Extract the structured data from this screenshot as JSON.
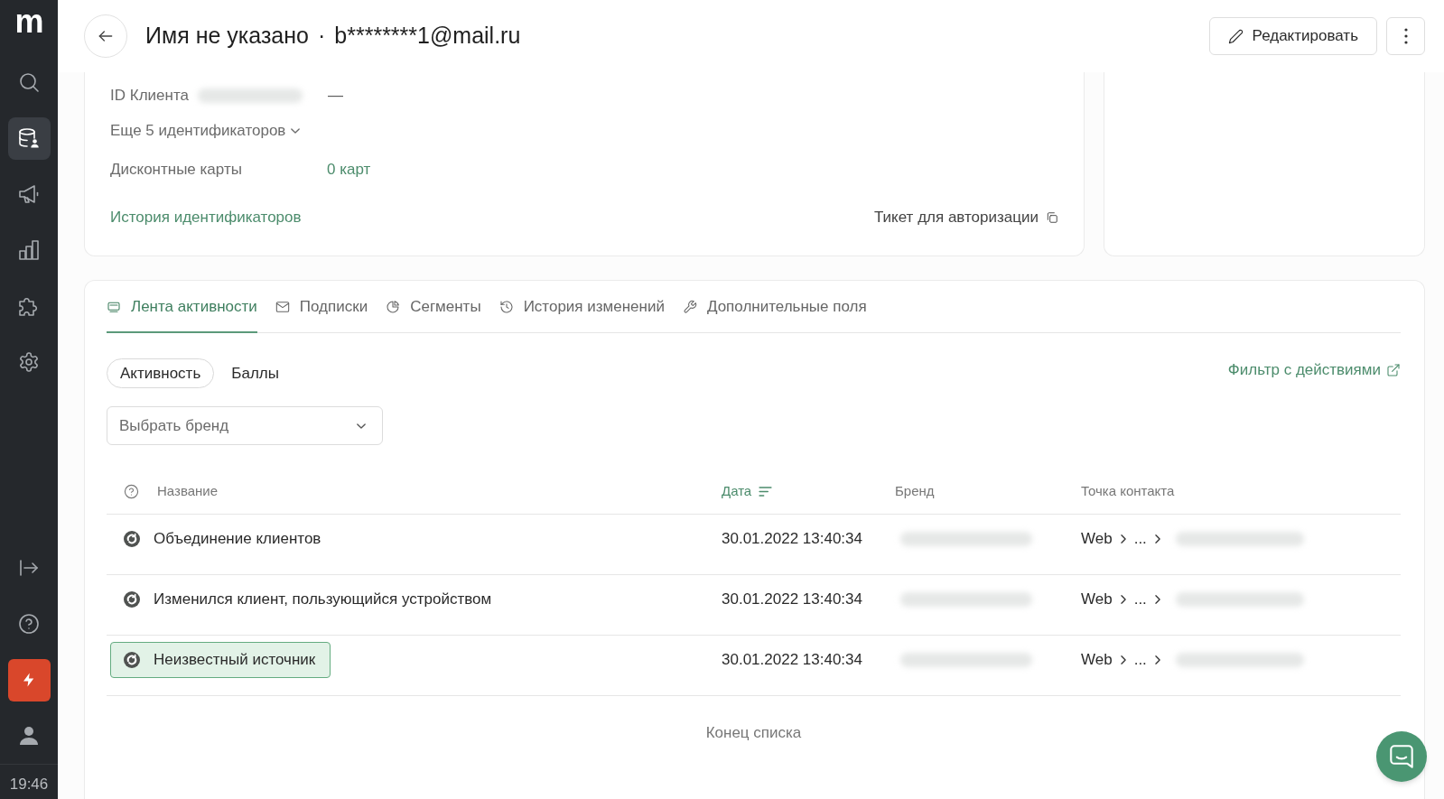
{
  "sidebar": {
    "logo": "m",
    "nav_items": [
      {
        "selected": false
      },
      {
        "selected": true
      },
      {
        "selected": false
      },
      {
        "selected": false
      },
      {
        "selected": false
      },
      {
        "selected": false
      }
    ],
    "time": "19:46"
  },
  "header": {
    "title": "Имя не указано",
    "separator": "·",
    "email": "b********1@mail.ru",
    "edit_button": "Редактировать"
  },
  "client_card": {
    "client_id": {
      "label": "ID Клиента",
      "redacted": true,
      "value": "—"
    },
    "more_identifiers": {
      "label": "Еще 5 идентификаторов",
      "expanded": false
    },
    "discount_cards": {
      "label": "Дисконтные карты",
      "value": "0 карт"
    },
    "history_link": "История идентификаторов",
    "ticket_link": "Тикет для авторизации"
  },
  "activity": {
    "tabs": [
      {
        "label": "Лента активности",
        "selected": true
      },
      {
        "label": "Подписки",
        "selected": false
      },
      {
        "label": "Сегменты",
        "selected": false
      },
      {
        "label": "История изменений",
        "selected": false
      },
      {
        "label": "Дополнительные поля",
        "selected": false
      }
    ],
    "view_toggle": [
      {
        "label": "Активность",
        "selected": true
      },
      {
        "label": "Баллы",
        "selected": false
      }
    ],
    "filter_link": "Фильтр с действиями",
    "brand_select": {
      "placeholder": "Выбрать бренд"
    },
    "table": {
      "columns": [
        {
          "label": "Название",
          "sorted": false
        },
        {
          "label": "Дата",
          "sorted": true
        },
        {
          "label": "Бренд",
          "sorted": false
        },
        {
          "label": "Точка контакта",
          "sorted": false
        }
      ],
      "rows": [
        {
          "name": "Объединение клиентов",
          "date": "30.01.2022 13:40:34",
          "brand_redacted": true,
          "contact_path": [
            "Web",
            "..."
          ],
          "contact_redacted": true,
          "selected": false
        },
        {
          "name": "Изменился клиент, пользующийся устройством",
          "date": "30.01.2022 13:40:34",
          "brand_redacted": true,
          "contact_path": [
            "Web",
            "..."
          ],
          "contact_redacted": true,
          "selected": false
        },
        {
          "name": "Неизвестный источник",
          "date": "30.01.2022 13:40:34",
          "brand_redacted": true,
          "contact_path": [
            "Web",
            "..."
          ],
          "contact_redacted": true,
          "selected": true
        }
      ]
    },
    "end_of_list": "Конец списка"
  }
}
